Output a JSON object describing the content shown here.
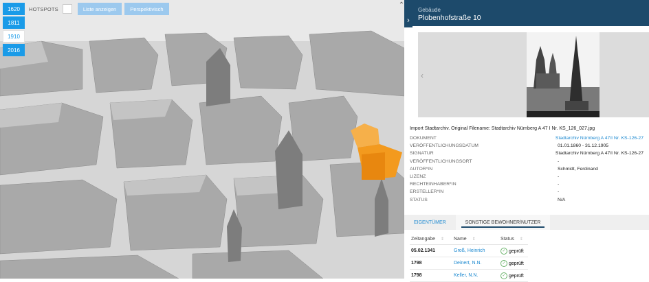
{
  "years": [
    {
      "label": "1620",
      "active": true
    },
    {
      "label": "1811",
      "active": true
    },
    {
      "label": "1910",
      "active": false
    },
    {
      "label": "2016",
      "active": true
    }
  ],
  "toolbar": {
    "hotspots_label": "HOTSPOTS",
    "list_label": "Liste anzeigen",
    "perspective_label": "Perspektivisch"
  },
  "colors": {
    "accent": "#1a9be8",
    "header": "#1d4a6b",
    "highlight": "#f39a1e",
    "link": "#1a88d0"
  },
  "icons": {
    "collapse": "chevron-up-icon",
    "panel_toggle": "chevron-right-icon",
    "gallery_prev": "chevron-left-icon",
    "status_ok": "check-circle-icon"
  },
  "panel": {
    "subtitle": "Gebäude",
    "title": "Plobenhofstraße 10",
    "caption": "Import Stadtarchiv. Original Filename: Stadtarchiv Nürnberg A 47 I Nr. KS_126_027.jpg",
    "details": [
      {
        "key": "DOKUMENT",
        "value": "Stadtarchiv Nürnberg A 47/I Nr. KS-126-27",
        "link": true
      },
      {
        "key": "VERÖFFENTLICHUNGSDATUM",
        "value": "01.01.1860 - 31.12.1905",
        "link": false
      },
      {
        "key": "SIGNATUR",
        "value": "Stadtarchiv Nürnberg A 47/I Nr. KS-126-27",
        "link": false
      },
      {
        "key": "VERÖFFENTLICHUNGSORT",
        "value": "-",
        "link": false
      },
      {
        "key": "AUTOR*IN",
        "value": "Schmidt, Ferdinand",
        "link": false
      },
      {
        "key": "LIZENZ",
        "value": "-",
        "link": false
      },
      {
        "key": "RECHTEINHABER*IN",
        "value": "-",
        "link": false
      },
      {
        "key": "ERSTELLER*IN",
        "value": "-",
        "link": false
      },
      {
        "key": "STATUS",
        "value": "N/A",
        "link": false
      }
    ],
    "tabs": [
      {
        "label": "EIGENTÜMER",
        "active": false
      },
      {
        "label": "SONSTIGE BEWOHNER/NUTZER",
        "active": true
      }
    ],
    "table": {
      "headers": [
        "Zeitangabe",
        "Name",
        "Status"
      ],
      "rows": [
        {
          "zeit": "05.02.1341",
          "name": "Groß, Heinrich",
          "status": "geprüft"
        },
        {
          "zeit": "1798",
          "name": "Deinert, N.N.",
          "status": "geprüft"
        },
        {
          "zeit": "1798",
          "name": "Keller, N.N.",
          "status": "geprüft"
        }
      ]
    }
  }
}
